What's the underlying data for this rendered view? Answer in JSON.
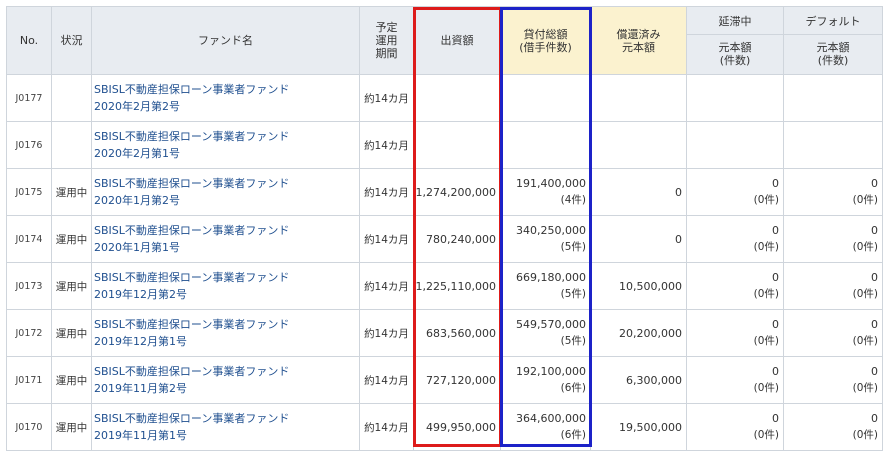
{
  "header": {
    "no": "No.",
    "status": "状況",
    "fund_name": "ファンド名",
    "period_l1": "予定",
    "period_l2": "運用",
    "period_l3": "期間",
    "investment": "出資額",
    "loan_l1": "貸付総額",
    "loan_l2": "(借手件数)",
    "repaid_l1": "償還済み",
    "repaid_l2": "元本額",
    "overdue": "延滞中",
    "overdue_sub_l1": "元本額",
    "overdue_sub_l2": "(件数)",
    "default": "デフォルト",
    "default_sub_l1": "元本額",
    "default_sub_l2": "(件数)"
  },
  "rows": [
    {
      "no": "J0177",
      "status": "",
      "fund_l1": "SBISL不動産担保ローン事業者ファンド",
      "fund_l2": "2020年2月第2号",
      "period": "約14カ月",
      "investment": "",
      "loan": "",
      "loan_count": "",
      "repaid": "",
      "overdue": "",
      "overdue_count": "",
      "default": "",
      "default_count": ""
    },
    {
      "no": "J0176",
      "status": "",
      "fund_l1": "SBISL不動産担保ローン事業者ファンド",
      "fund_l2": "2020年2月第1号",
      "period": "約14カ月",
      "investment": "",
      "loan": "",
      "loan_count": "",
      "repaid": "",
      "overdue": "",
      "overdue_count": "",
      "default": "",
      "default_count": ""
    },
    {
      "no": "J0175",
      "status": "運用中",
      "fund_l1": "SBISL不動産担保ローン事業者ファンド",
      "fund_l2": "2020年1月第2号",
      "period": "約14カ月",
      "investment": "1,274,200,000",
      "loan": "191,400,000",
      "loan_count": "(4件)",
      "repaid": "0",
      "overdue": "0",
      "overdue_count": "(0件)",
      "default": "0",
      "default_count": "(0件)"
    },
    {
      "no": "J0174",
      "status": "運用中",
      "fund_l1": "SBISL不動産担保ローン事業者ファンド",
      "fund_l2": "2020年1月第1号",
      "period": "約14カ月",
      "investment": "780,240,000",
      "loan": "340,250,000",
      "loan_count": "(5件)",
      "repaid": "0",
      "overdue": "0",
      "overdue_count": "(0件)",
      "default": "0",
      "default_count": "(0件)"
    },
    {
      "no": "J0173",
      "status": "運用中",
      "fund_l1": "SBISL不動産担保ローン事業者ファンド",
      "fund_l2": "2019年12月第2号",
      "period": "約14カ月",
      "investment": "1,225,110,000",
      "loan": "669,180,000",
      "loan_count": "(5件)",
      "repaid": "10,500,000",
      "overdue": "0",
      "overdue_count": "(0件)",
      "default": "0",
      "default_count": "(0件)"
    },
    {
      "no": "J0172",
      "status": "運用中",
      "fund_l1": "SBISL不動産担保ローン事業者ファンド",
      "fund_l2": "2019年12月第1号",
      "period": "約14カ月",
      "investment": "683,560,000",
      "loan": "549,570,000",
      "loan_count": "(5件)",
      "repaid": "20,200,000",
      "overdue": "0",
      "overdue_count": "(0件)",
      "default": "0",
      "default_count": "(0件)"
    },
    {
      "no": "J0171",
      "status": "運用中",
      "fund_l1": "SBISL不動産担保ローン事業者ファンド",
      "fund_l2": "2019年11月第2号",
      "period": "約14カ月",
      "investment": "727,120,000",
      "loan": "192,100,000",
      "loan_count": "(6件)",
      "repaid": "6,300,000",
      "overdue": "0",
      "overdue_count": "(0件)",
      "default": "0",
      "default_count": "(0件)"
    },
    {
      "no": "J0170",
      "status": "運用中",
      "fund_l1": "SBISL不動産担保ローン事業者ファンド",
      "fund_l2": "2019年11月第1号",
      "period": "約14カ月",
      "investment": "499,950,000",
      "loan": "364,600,000",
      "loan_count": "(6件)",
      "repaid": "19,500,000",
      "overdue": "0",
      "overdue_count": "(0件)",
      "default": "0",
      "default_count": "(0件)"
    }
  ],
  "highlight_colors": {
    "investment_box": "#dd1b1b",
    "loan_box": "#1c22c8",
    "yellow_header": "#fbf2cf"
  }
}
